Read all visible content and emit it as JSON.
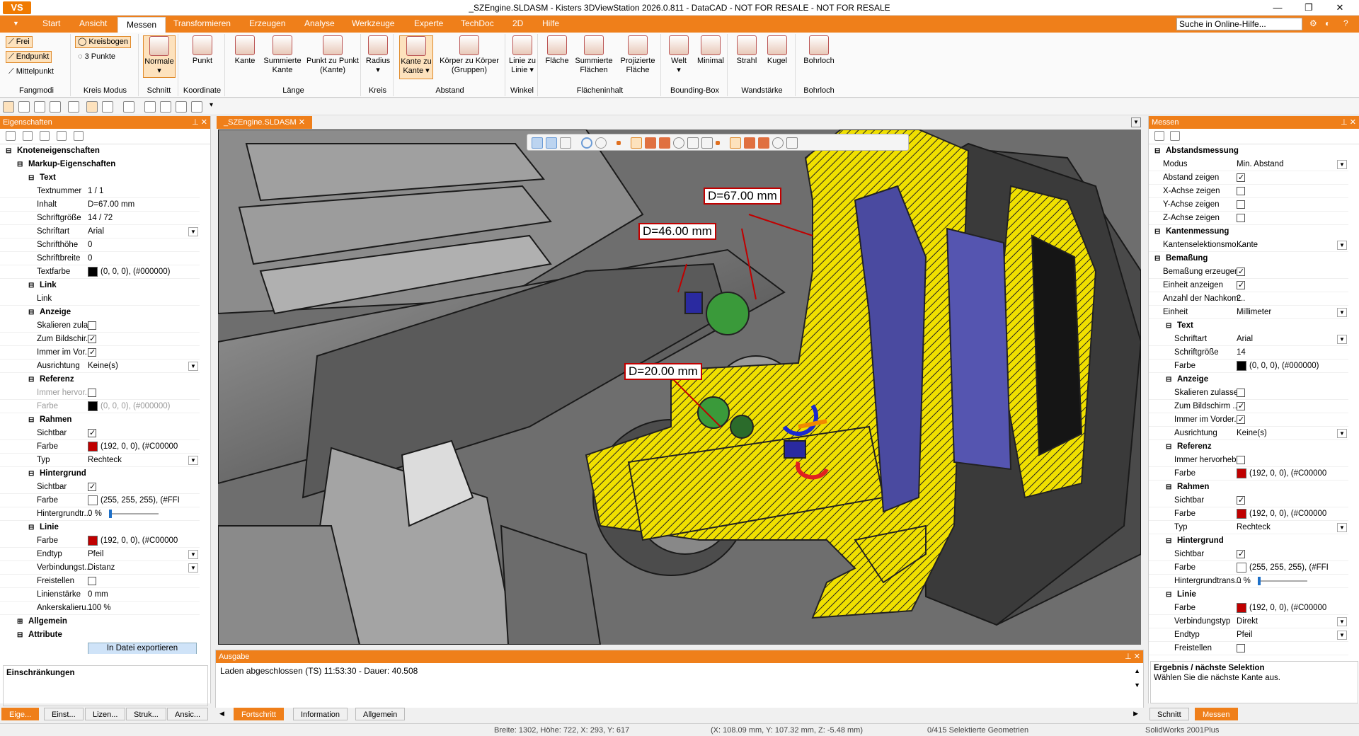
{
  "window": {
    "title": "_SZEngine.SLDASM - Kisters 3DViewStation 2026.0.811 - DataCAD - NOT FOR RESALE - NOT FOR RESALE",
    "logo": "VS"
  },
  "menu": {
    "tabs": [
      "Start",
      "Ansicht",
      "Messen",
      "Transformieren",
      "Erzeugen",
      "Analyse",
      "Werkzeuge",
      "Experte",
      "TechDoc",
      "2D",
      "Hilfe"
    ],
    "active": "Messen",
    "search_placeholder": "Suche in Online-Hilfe..."
  },
  "ribbon": {
    "fangmodi": {
      "label": "Fangmodi",
      "items": [
        "Frei",
        "Endpunkt",
        "Mittelpunkt"
      ]
    },
    "kreismodus": {
      "label": "Kreis Modus",
      "items": [
        "Kreisbogen",
        "3 Punkte"
      ]
    },
    "schnitt": {
      "label": "Schnitt",
      "button": "Normale"
    },
    "koordinate": {
      "label": "Koordinate",
      "button": "Punkt"
    },
    "laenge": {
      "label": "Länge",
      "buttons": [
        "Kante",
        "Summierte Kante",
        "Punkt zu Punkt (Kante)"
      ]
    },
    "kreis": {
      "label": "Kreis",
      "button": "Radius"
    },
    "abstand": {
      "label": "Abstand",
      "buttons": [
        "Kante zu Kante",
        "Körper zu Körper (Gruppen)"
      ]
    },
    "winkel": {
      "label": "Winkel",
      "button": "Linie zu Linie"
    },
    "flaecheninhalt": {
      "label": "Flächeninhalt",
      "buttons": [
        "Fläche",
        "Summierte Flächen",
        "Projizierte Fläche"
      ]
    },
    "boundingbox": {
      "label": "Bounding-Box",
      "buttons": [
        "Welt",
        "Minimal"
      ]
    },
    "wandstaerke": {
      "label": "Wandstärke",
      "buttons": [
        "Strahl",
        "Kugel"
      ]
    },
    "bohrloch": {
      "label": "Bohrloch",
      "button": "Bohrloch"
    }
  },
  "left_panel": {
    "title": "Eigenschaften",
    "rows": [
      {
        "type": "section",
        "label": "Knoteneigenschaften",
        "level": 0
      },
      {
        "type": "section",
        "label": "Markup-Eigenschaften",
        "level": 1
      },
      {
        "type": "section",
        "label": "Text",
        "level": 2
      },
      {
        "type": "prop",
        "label": "Textnummer",
        "value": "1 / 1"
      },
      {
        "type": "prop",
        "label": "Inhalt",
        "value": "D=67.00 mm"
      },
      {
        "type": "prop",
        "label": "Schriftgröße",
        "value": "14 / 72"
      },
      {
        "type": "prop",
        "label": "Schriftart",
        "value": "Arial",
        "dropdown": true
      },
      {
        "type": "prop",
        "label": "Schrifthöhe",
        "value": "0"
      },
      {
        "type": "prop",
        "label": "Schriftbreite",
        "value": "0"
      },
      {
        "type": "prop",
        "label": "Textfarbe",
        "value": "(0, 0, 0), (#000000)",
        "swatch": "#000000"
      },
      {
        "type": "section",
        "label": "Link",
        "level": 2
      },
      {
        "type": "prop",
        "label": "Link",
        "value": ""
      },
      {
        "type": "section",
        "label": "Anzeige",
        "level": 2
      },
      {
        "type": "prop",
        "label": "Skalieren zula...",
        "check": false
      },
      {
        "type": "prop",
        "label": "Zum Bildschir...",
        "check": true
      },
      {
        "type": "prop",
        "label": "Immer im Vor...",
        "check": true
      },
      {
        "type": "prop",
        "label": "Ausrichtung",
        "value": "Keine(s)",
        "dropdown": true
      },
      {
        "type": "section",
        "label": "Referenz",
        "level": 2
      },
      {
        "type": "prop",
        "label": "Immer hervor...",
        "check": false,
        "disabled": true
      },
      {
        "type": "prop",
        "label": "Farbe",
        "value": "(0, 0, 0), (#000000)",
        "swatch": "#000000",
        "disabled": true
      },
      {
        "type": "section",
        "label": "Rahmen",
        "level": 2
      },
      {
        "type": "prop",
        "label": "Sichtbar",
        "check": true
      },
      {
        "type": "prop",
        "label": "Farbe",
        "value": "(192, 0, 0), (#C00000",
        "swatch": "#c00000"
      },
      {
        "type": "prop",
        "label": "Typ",
        "value": "Rechteck",
        "dropdown": true
      },
      {
        "type": "section",
        "label": "Hintergrund",
        "level": 2
      },
      {
        "type": "prop",
        "label": "Sichtbar",
        "check": true
      },
      {
        "type": "prop",
        "label": "Farbe",
        "value": "(255, 255, 255), (#FFI",
        "swatch": "#ffffff"
      },
      {
        "type": "prop",
        "label": "Hintergrundtr...",
        "value": "0 %",
        "slider": true
      },
      {
        "type": "section",
        "label": "Linie",
        "level": 2
      },
      {
        "type": "prop",
        "label": "Farbe",
        "value": "(192, 0, 0), (#C00000",
        "swatch": "#c00000"
      },
      {
        "type": "prop",
        "label": "Endtyp",
        "value": "Pfeil",
        "dropdown": true
      },
      {
        "type": "prop",
        "label": "Verbindungst...",
        "value": "Distanz",
        "dropdown": true
      },
      {
        "type": "prop",
        "label": "Freistellen",
        "check": false
      },
      {
        "type": "prop",
        "label": "Linienstärke",
        "value": "0 mm"
      },
      {
        "type": "prop",
        "label": "Ankerskalieru...",
        "value": "100 %"
      },
      {
        "type": "section",
        "label": "Allgemein",
        "level": 1,
        "collapsed": true
      },
      {
        "type": "section",
        "label": "Attribute",
        "level": 1
      },
      {
        "type": "button",
        "label": "In Datei exportieren"
      }
    ],
    "restrictions_label": "Einschränkungen",
    "bottom_tabs": [
      "Eige...",
      "Einst...",
      "Lizen...",
      "Struk...",
      "Ansic..."
    ]
  },
  "document": {
    "tab": "_SZEngine.SLDASM",
    "measurements": [
      "D=67.00 mm",
      "D=46.00 mm",
      "D=20.00 mm"
    ]
  },
  "output": {
    "title": "Ausgabe",
    "line": "Laden abgeschlossen (TS) 11:53:30 - Dauer: 40.508",
    "tabs": [
      "Fortschritt",
      "Information",
      "Allgemein"
    ],
    "active_tab": "Fortschritt"
  },
  "right_panel": {
    "title": "Messen",
    "rows": [
      {
        "type": "section",
        "label": "Abstandsmessung",
        "level": 0
      },
      {
        "type": "prop",
        "label": "Modus",
        "value": "Min. Abstand",
        "dropdown": true
      },
      {
        "type": "prop",
        "label": "Abstand zeigen",
        "check": true
      },
      {
        "type": "prop",
        "label": "X-Achse zeigen",
        "check": false
      },
      {
        "type": "prop",
        "label": "Y-Achse zeigen",
        "check": false
      },
      {
        "type": "prop",
        "label": "Z-Achse zeigen",
        "check": false
      },
      {
        "type": "section",
        "label": "Kantenmessung",
        "level": 0
      },
      {
        "type": "prop",
        "label": "Kantenselektionsmo...",
        "value": "Kante",
        "dropdown": true
      },
      {
        "type": "section",
        "label": "Bemaßung",
        "level": 0
      },
      {
        "type": "prop",
        "label": "Bemaßung erzeugen",
        "check": true
      },
      {
        "type": "prop",
        "label": "Einheit anzeigen",
        "check": true
      },
      {
        "type": "prop",
        "label": "Anzahl der Nachkom...",
        "value": "2"
      },
      {
        "type": "prop",
        "label": "Einheit",
        "value": "Millimeter",
        "dropdown": true
      },
      {
        "type": "section",
        "label": "Text",
        "level": 1
      },
      {
        "type": "prop",
        "label": "Schriftart",
        "value": "Arial",
        "dropdown": true,
        "indent": true
      },
      {
        "type": "prop",
        "label": "Schriftgröße",
        "value": "14",
        "indent": true
      },
      {
        "type": "prop",
        "label": "Farbe",
        "value": "(0, 0, 0), (#000000)",
        "swatch": "#000000",
        "indent": true
      },
      {
        "type": "section",
        "label": "Anzeige",
        "level": 1
      },
      {
        "type": "prop",
        "label": "Skalieren zulassen",
        "check": false,
        "indent": true
      },
      {
        "type": "prop",
        "label": "Zum Bildschirm ...",
        "check": true,
        "indent": true
      },
      {
        "type": "prop",
        "label": "Immer im Vorder...",
        "check": true,
        "indent": true
      },
      {
        "type": "prop",
        "label": "Ausrichtung",
        "value": "Keine(s)",
        "dropdown": true,
        "indent": true
      },
      {
        "type": "section",
        "label": "Referenz",
        "level": 1
      },
      {
        "type": "prop",
        "label": "Immer hervorheb...",
        "check": false,
        "indent": true
      },
      {
        "type": "prop",
        "label": "Farbe",
        "value": "(192, 0, 0), (#C00000",
        "swatch": "#c00000",
        "indent": true
      },
      {
        "type": "section",
        "label": "Rahmen",
        "level": 1
      },
      {
        "type": "prop",
        "label": "Sichtbar",
        "check": true,
        "indent": true
      },
      {
        "type": "prop",
        "label": "Farbe",
        "value": "(192, 0, 0), (#C00000",
        "swatch": "#c00000",
        "indent": true
      },
      {
        "type": "prop",
        "label": "Typ",
        "value": "Rechteck",
        "dropdown": true,
        "indent": true
      },
      {
        "type": "section",
        "label": "Hintergrund",
        "level": 1
      },
      {
        "type": "prop",
        "label": "Sichtbar",
        "check": true,
        "indent": true
      },
      {
        "type": "prop",
        "label": "Farbe",
        "value": "(255, 255, 255), (#FFI",
        "swatch": "#ffffff",
        "indent": true
      },
      {
        "type": "prop",
        "label": "Hintergrundtrans...",
        "value": "0 %",
        "slider": true,
        "indent": true
      },
      {
        "type": "section",
        "label": "Linie",
        "level": 1
      },
      {
        "type": "prop",
        "label": "Farbe",
        "value": "(192, 0, 0), (#C00000",
        "swatch": "#c00000",
        "indent": true
      },
      {
        "type": "prop",
        "label": "Verbindungstyp",
        "value": "Direkt",
        "dropdown": true,
        "indent": true
      },
      {
        "type": "prop",
        "label": "Endtyp",
        "value": "Pfeil",
        "dropdown": true,
        "indent": true
      },
      {
        "type": "prop",
        "label": "Freistellen",
        "check": false,
        "indent": true
      }
    ],
    "result_title": "Ergebnis / nächste Selektion",
    "result_text": "Wählen Sie die nächste Kante aus.",
    "bottom_tabs": [
      "Schnitt",
      "Messen"
    ],
    "active_tab": "Messen"
  },
  "status": {
    "size": "Breite: 1302, Höhe: 722, X: 293, Y: 617",
    "coords": "(X: 108.09 mm, Y: 107.32 mm, Z: -5.48 mm)",
    "selection": "0/415 Selektierte Geometrien",
    "format": "SolidWorks 2001Plus"
  },
  "colors": {
    "accent": "#ef7f1a",
    "measure": "#c00000",
    "cut": "#f0e000"
  }
}
